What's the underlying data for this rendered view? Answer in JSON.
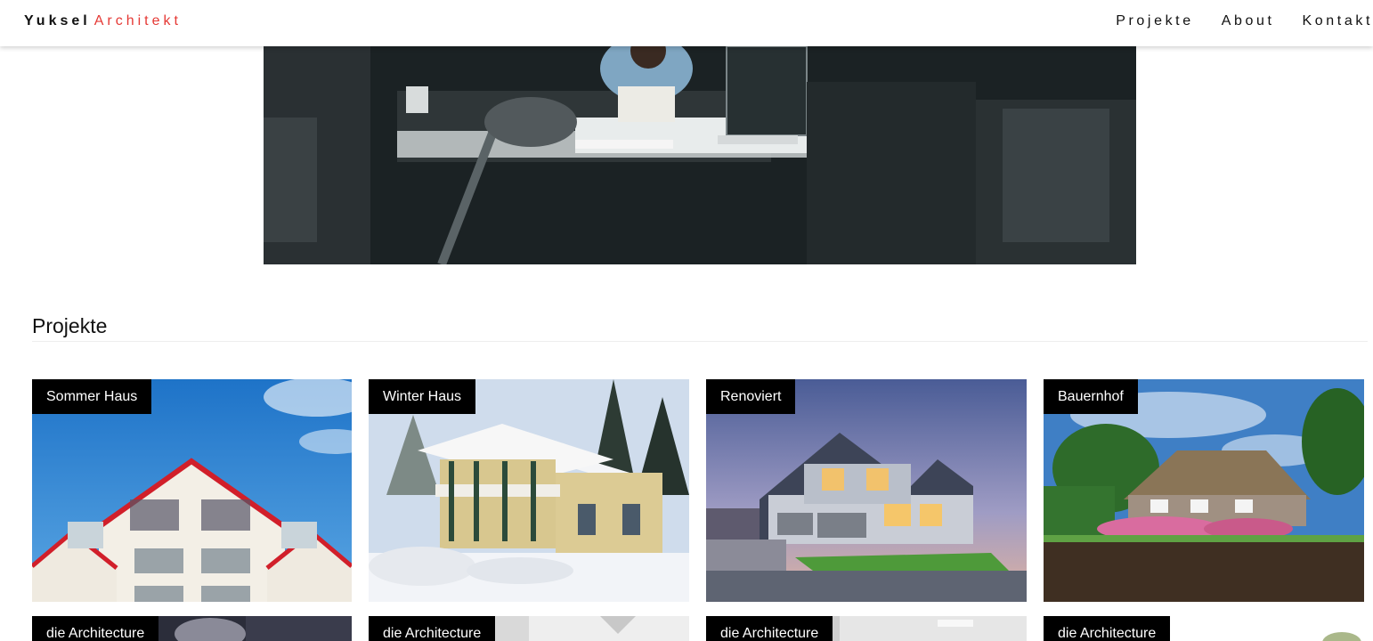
{
  "brand": {
    "first": "Yuksel",
    "second": "Architekt"
  },
  "nav": {
    "items": [
      "Projekte",
      "About",
      "Kontakt"
    ]
  },
  "projects": {
    "heading": "Projekte",
    "cards": [
      "Sommer Haus",
      "Winter Haus",
      "Renoviert",
      "Bauernhof"
    ],
    "cards_row2": [
      "die Architecture",
      "die Architecture",
      "die Architecture",
      "die Architecture"
    ]
  },
  "colors": {
    "accent": "#e53935",
    "label_bg": "#000000",
    "label_text": "#ffffff"
  }
}
